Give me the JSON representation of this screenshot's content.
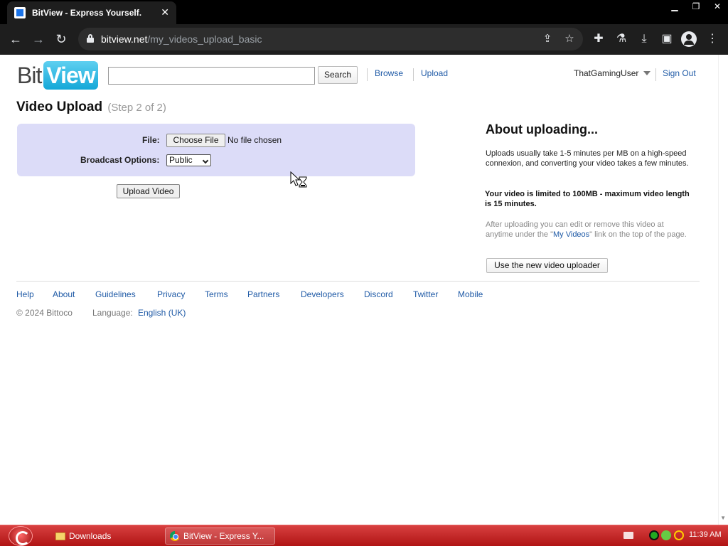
{
  "browser": {
    "tab_title": "BitView - Express Yourself.",
    "tab_close": "✕",
    "url_host": "bitview.net",
    "url_path": "/my_videos_upload_basic"
  },
  "site": {
    "logo_bit": "Bit",
    "logo_view": "View",
    "search_button": "Search",
    "nav": {
      "browse": "Browse",
      "upload": "Upload"
    },
    "username": "ThatGamingUser",
    "sign_out": "Sign Out"
  },
  "upload": {
    "title": "Video Upload",
    "step": "(Step 2 of 2)",
    "file_label": "File:",
    "choose_file": "Choose File",
    "no_file": "No file chosen",
    "broadcast_label": "Broadcast Options:",
    "broadcast_selected": "Public",
    "upload_button": "Upload Video"
  },
  "about": {
    "title": "About uploading...",
    "p1": "Uploads usually take 1-5 minutes per MB on a high-speed connexion, and converting your video takes a few minutes.",
    "p2": "Your video is limited to 100MB - maximum video length is 15 minutes.",
    "p3_before": "After uploading you can edit or remove this video at anytime under the \"",
    "p3_link": "My Videos",
    "p3_after": "\" link on the top of the page.",
    "new_uploader_button": "Use the new video uploader"
  },
  "footer": {
    "links": [
      "Help",
      "About",
      "Guidelines",
      "Privacy",
      "Terms",
      "Partners",
      "Developers",
      "Discord",
      "Twitter",
      "Mobile"
    ],
    "copyright": "© 2024 Bittoco",
    "language_label": "Language:",
    "language_value": "English (UK)"
  },
  "taskbar": {
    "items": [
      "Downloads",
      "BitView - Express Y..."
    ],
    "clock": "11:39 AM"
  },
  "colors": {
    "link": "#1f5aa6",
    "panel": "#dcdcf8",
    "taskbar": "#b01414"
  }
}
